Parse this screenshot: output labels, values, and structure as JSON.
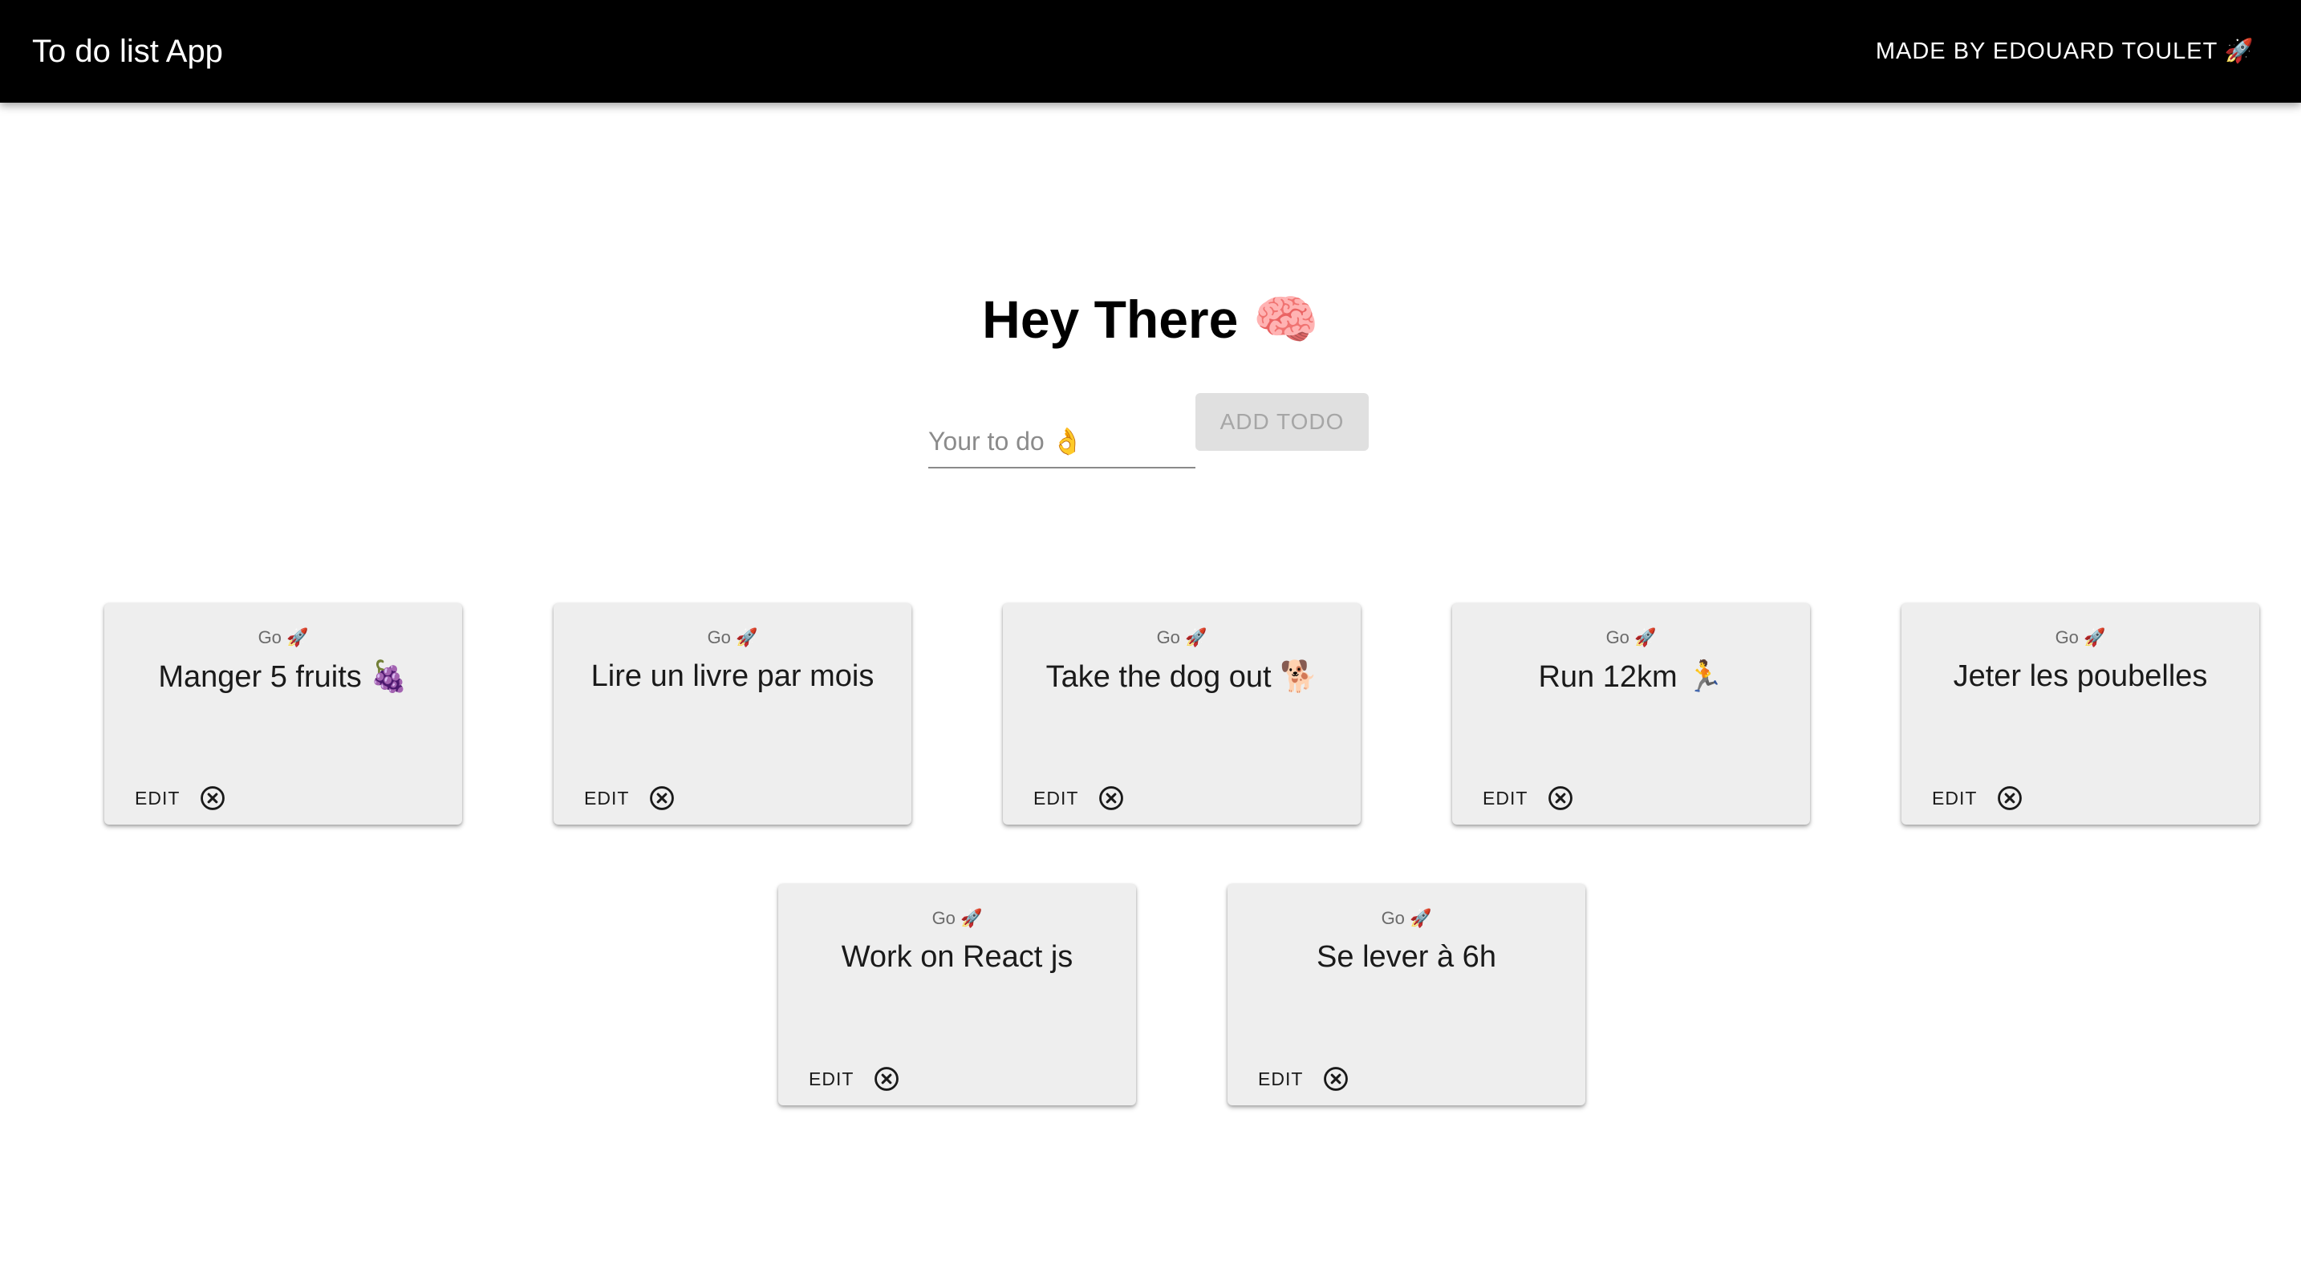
{
  "header": {
    "title": "To do list App",
    "credit": "MADE BY EDOUARD TOULET 🚀"
  },
  "main": {
    "heading": "Hey There 🧠",
    "input": {
      "placeholder": "Your to do 👌",
      "value": ""
    },
    "add_button_label": "ADD TODO"
  },
  "todos": [
    {
      "subtitle": "Go 🚀",
      "title": "Manger 5 fruits 🍇",
      "edit_label": "EDIT",
      "delete_icon": "cancel-circle-icon"
    },
    {
      "subtitle": "Go 🚀",
      "title": "Lire un livre par mois",
      "edit_label": "EDIT",
      "delete_icon": "cancel-circle-icon"
    },
    {
      "subtitle": "Go 🚀",
      "title": "Take the dog out 🐕",
      "edit_label": "EDIT",
      "delete_icon": "cancel-circle-icon"
    },
    {
      "subtitle": "Go 🚀",
      "title": "Run 12km 🏃",
      "edit_label": "EDIT",
      "delete_icon": "cancel-circle-icon"
    },
    {
      "subtitle": "Go 🚀",
      "title": "Jeter les poubelles",
      "edit_label": "EDIT",
      "delete_icon": "cancel-circle-icon"
    },
    {
      "subtitle": "Go 🚀",
      "title": "Work on React js",
      "edit_label": "EDIT",
      "delete_icon": "cancel-circle-icon"
    },
    {
      "subtitle": "Go 🚀",
      "title": "Se lever à 6h",
      "edit_label": "EDIT",
      "delete_icon": "cancel-circle-icon"
    }
  ],
  "colors": {
    "appbar": "#000000",
    "card_background": "#eeeeee",
    "button_disabled_background": "#e0e0e0",
    "button_disabled_text": "#a6a6a6"
  }
}
